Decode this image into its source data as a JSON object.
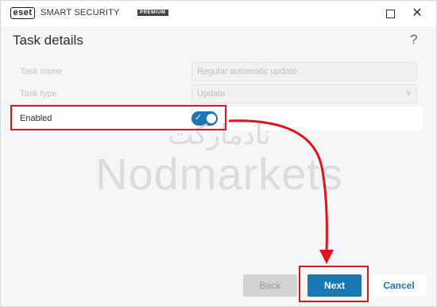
{
  "titlebar": {
    "logo_text": "eset",
    "app_name": "SMART SECURITY",
    "edition": "PREMIUM"
  },
  "header": {
    "title": "Task details",
    "help_icon": "?"
  },
  "form": {
    "task_name": {
      "label": "Task name",
      "value": "Regular automatic update"
    },
    "task_type": {
      "label": "Task type",
      "value": "Update",
      "arrow": "∨"
    },
    "enabled": {
      "label": "Enabled",
      "state": true,
      "check": "✓"
    }
  },
  "watermark": {
    "persian": "نادمارکت",
    "english": "Nodmarkets"
  },
  "footer": {
    "back_label": "Back",
    "next_label": "Next",
    "cancel_label": "Cancel"
  },
  "colors": {
    "accent": "#1a77b2",
    "annotation": "#e0141d"
  }
}
